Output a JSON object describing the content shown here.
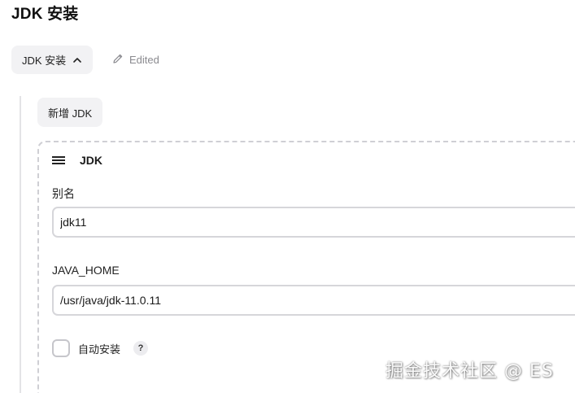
{
  "header": {
    "title": "JDK 安装"
  },
  "section": {
    "toggle_label": "JDK 安装",
    "toggle_icon": "chevron-up-icon",
    "edited_label": "Edited",
    "edited_icon": "pencil-icon"
  },
  "add_button": {
    "label": "新增 JDK"
  },
  "jdk_card": {
    "title": "JDK",
    "drag_icon": "drag-handle-icon",
    "alias": {
      "label": "别名",
      "value": "jdk11"
    },
    "java_home": {
      "label": "JAVA_HOME",
      "value": "/usr/java/jdk-11.0.11"
    },
    "auto_install": {
      "label": "自动安装",
      "checked": false,
      "help_glyph": "?"
    }
  },
  "watermark": {
    "text": "掘金技术社区 @ ES"
  },
  "colors": {
    "button_bg": "#f2f2f4",
    "border": "#d6d6da",
    "muted_text": "#8a8a8f"
  }
}
